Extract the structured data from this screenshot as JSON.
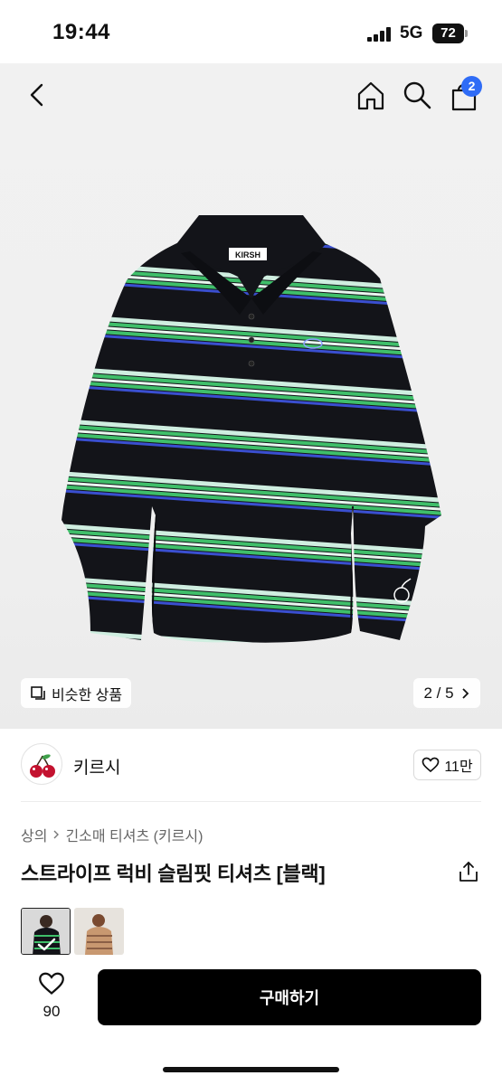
{
  "status_bar": {
    "time": "19:44",
    "network": "5G",
    "battery": "72"
  },
  "nav": {
    "cart_count": "2"
  },
  "gallery": {
    "similar_label": "비슷한 상품",
    "page": "2 / 5"
  },
  "brand": {
    "name": "키르시",
    "likes": "11만"
  },
  "product": {
    "breadcrumb": [
      "상의",
      "긴소매 티셔츠 (키르시)"
    ],
    "title": "스트라이프 럭비 슬림핏 티셔츠 [블랙]",
    "garment_logo": "KIRSH"
  },
  "bottom_bar": {
    "wish_count": "90",
    "buy_label": "구매하기"
  },
  "colors": {
    "accent_badge": "#2f6cf6",
    "buy_button": "#000000",
    "stripe_green": "#3fbf6a",
    "stripe_blue": "#3a4fd0",
    "stripe_mint": "#cfeee0",
    "shirt_black": "#131419"
  }
}
